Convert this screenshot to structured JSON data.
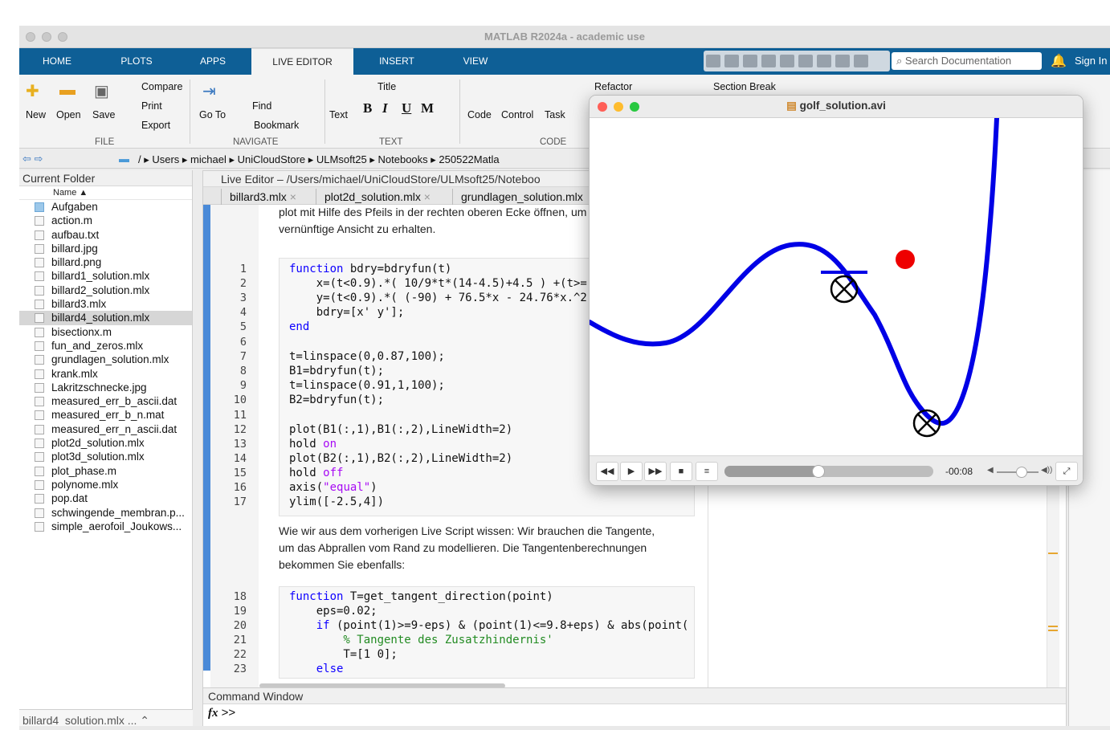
{
  "window": {
    "title": "MATLAB R2024a - academic use"
  },
  "tabs": [
    {
      "label": "HOME"
    },
    {
      "label": "PLOTS"
    },
    {
      "label": "APPS"
    },
    {
      "label": "LIVE EDITOR"
    },
    {
      "label": "INSERT"
    },
    {
      "label": "VIEW"
    }
  ],
  "search": {
    "placeholder": "Search Documentation"
  },
  "signin": "Sign In",
  "ribbon": {
    "new": "New",
    "open": "Open",
    "save": "Save",
    "compare": "Compare",
    "print": "Print",
    "export": "Export",
    "goto": "Go To",
    "find": "Find",
    "bookmark": "Bookmark",
    "text": "Text",
    "title": "Title",
    "bold": "B",
    "italic": "I",
    "underline": "U",
    "mono": "M",
    "code": "Code",
    "control": "Control",
    "task": "Task",
    "refactor": "Refactor",
    "section_break": "Section Break",
    "groups": {
      "file": "FILE",
      "navigate": "NAVIGATE",
      "text": "TEXT",
      "code": "CODE"
    }
  },
  "address": {
    "path": "/ ▸ Users ▸ michael ▸ UniCloudStore ▸ ULMsoft25 ▸ Notebooks ▸ 250522Matla"
  },
  "current_folder": {
    "title": "Current Folder",
    "column": "Name ▲",
    "items": [
      {
        "name": "Aufgaben",
        "type": "folder"
      },
      {
        "name": "action.m"
      },
      {
        "name": "aufbau.txt"
      },
      {
        "name": "billard.jpg"
      },
      {
        "name": "billard.png"
      },
      {
        "name": "billard1_solution.mlx"
      },
      {
        "name": "billard2_solution.mlx"
      },
      {
        "name": "billard3.mlx"
      },
      {
        "name": "billard4_solution.mlx",
        "selected": true
      },
      {
        "name": "bisectionx.m"
      },
      {
        "name": "fun_and_zeros.mlx"
      },
      {
        "name": "grundlagen_solution.mlx"
      },
      {
        "name": "krank.mlx"
      },
      {
        "name": "Lakritzschnecke.jpg"
      },
      {
        "name": "measured_err_b_ascii.dat"
      },
      {
        "name": "measured_err_b_n.mat"
      },
      {
        "name": "measured_err_n_ascii.dat"
      },
      {
        "name": "plot2d_solution.mlx"
      },
      {
        "name": "plot3d_solution.mlx"
      },
      {
        "name": "plot_phase.m"
      },
      {
        "name": "polynome.mlx"
      },
      {
        "name": "pop.dat"
      },
      {
        "name": "schwingende_membran.p..."
      },
      {
        "name": "simple_aerofoil_Joukows..."
      }
    ],
    "footer": "billard4_solution.mlx ..."
  },
  "editor": {
    "title": "Live Editor – /Users/michael/UniCloudStore/ULMsoft25/Noteboo",
    "tabs": [
      {
        "label": "billard3.mlx"
      },
      {
        "label": "plot2d_solution.mlx"
      },
      {
        "label": "grundlagen_solution.mlx"
      }
    ],
    "text1a": "plot mit Hilfe des Pfeils in der rechten oberen Ecke öffnen, um",
    "text1b": "vernünftige Ansicht zu erhalten.",
    "text2a": "Wie wir aus dem vorherigen Live Script wissen: Wir brauchen die Tangente,",
    "text2b": "um das Abprallen vom Rand zu modellieren. Die Tangentenberechnungen",
    "text2c": "bekommen Sie ebenfalls:",
    "lines": [
      "1",
      "2",
      "3",
      "4",
      "5",
      "6",
      "7",
      "8",
      "9",
      "10",
      "11",
      "12",
      "13",
      "14",
      "15",
      "16",
      "17",
      "18",
      "19",
      "20",
      "21",
      "22",
      "23"
    ],
    "code": {
      "c1a": "function",
      "c1b": " bdry=bdryfun(t)",
      "c2": "    x=(t<0.9).*( 10/9*t*(14-4.5)+4.5 ) +(t>=",
      "c3": "    y=(t<0.9).*( (-90) + 76.5*x - 24.76*x.^2",
      "c4": "    bdry=[x' y'];",
      "c5": "end",
      "c7": "t=linspace(0,0.87,100);",
      "c8": "B1=bdryfun(t);",
      "c9": "t=linspace(0.91,1,100);",
      "c10": "B2=bdryfun(t);",
      "c12": "plot(B1(:,1),B1(:,2),LineWidth=2)",
      "c13a": "hold ",
      "c13b": "on",
      "c14": "plot(B2(:,1),B2(:,2),LineWidth=2)",
      "c15a": "hold ",
      "c15b": "off",
      "c16a": "axis(",
      "c16b": "\"equal\"",
      "c16c": ")",
      "c17": "ylim([-2.5,4])",
      "c18a": "function",
      "c18b": " T=get_tangent_direction(point)",
      "c19": "    eps=0.02;",
      "c20a": "    if",
      "c20b": " (point(1)>=9-eps) & (point(1)<=9.8+eps) & abs(point(",
      "c21": "        % Tangente des Zusatzhindernis'",
      "c22": "        T=[1 0];",
      "c23": "    else"
    }
  },
  "command_window": {
    "title": "Command Window",
    "prompt": ">>"
  },
  "video": {
    "title": "golf_solution.avi",
    "time": "-00:08",
    "progress": 0.45,
    "volume": 0.6,
    "colors": {
      "curve": "#0000e6",
      "ball": "#ee0000"
    }
  }
}
